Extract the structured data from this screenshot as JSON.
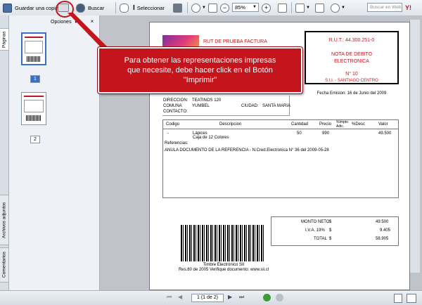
{
  "toolbar": {
    "save_label": "Guardar una copia",
    "search_label": "Buscar",
    "select_label": "Seleccionar",
    "zoom_value": "85%",
    "search_web_placeholder": "Buscar en Web"
  },
  "left_panel": {
    "options_label": "Opciones",
    "tabs": [
      "Páginas",
      "Archivos adjuntos",
      "Comentarios"
    ],
    "thumbnails": [
      "1",
      "2"
    ]
  },
  "callout": {
    "line1": "Para obtener las representaciones impresas",
    "line2": "que necesite, debe hacer click en el Botón",
    "line3": "\"Imprimir\""
  },
  "document": {
    "company_title": "RUT DE PRUEBA FACTURA",
    "rut": "R.U.T.: 44.300.251-0",
    "doc_type_1": "NOTA DE DEBITO",
    "doc_type_2": "ELECTRONICA",
    "doc_number": "N° 10",
    "sii": "S.I.I. - SANTIAGO CENTRO",
    "fecha": "Fecha Emision: 16 de Junio del 2009",
    "direccion_label": "DIRECCION:",
    "direccion_value": "TEATINOS 120",
    "comuna_label": "COMUNA",
    "comuna_value": "YUMBEL",
    "ciudad_label": "CIUDAD:",
    "ciudad_value": "SANTA MARIA",
    "contacto_label": "CONTACTO:",
    "columns": [
      "Codigo",
      "Descripcion",
      "Cantidad",
      "Precio",
      "%Impto Adic.",
      "%Desc",
      "Valor"
    ],
    "item": {
      "code": "-",
      "desc": "Lápices",
      "desc2": "Caja de 12 Colores",
      "qty": "50",
      "price": "990",
      "value": "49.500"
    },
    "referencias_label": "Referencias:",
    "referencia": "ANULA DOCUMENTO DE LA REFERENCIA - N.Cred.Electronica N° 36 del 2009-05-28",
    "totals": [
      {
        "label": "MONTO NETO",
        "cur": "$",
        "value": "49.500"
      },
      {
        "label": "I.V.A. 19%",
        "cur": "$",
        "value": "9.405"
      },
      {
        "label": "TOTAL",
        "cur": "$",
        "value": "58.905"
      }
    ],
    "timbre_1": "Timbre Electrónico SII",
    "timbre_2": "Res.80 de 2005 Verifique documento: www.sii.cl"
  },
  "pagination": {
    "page_indicator": "1 (1 de 2)"
  }
}
